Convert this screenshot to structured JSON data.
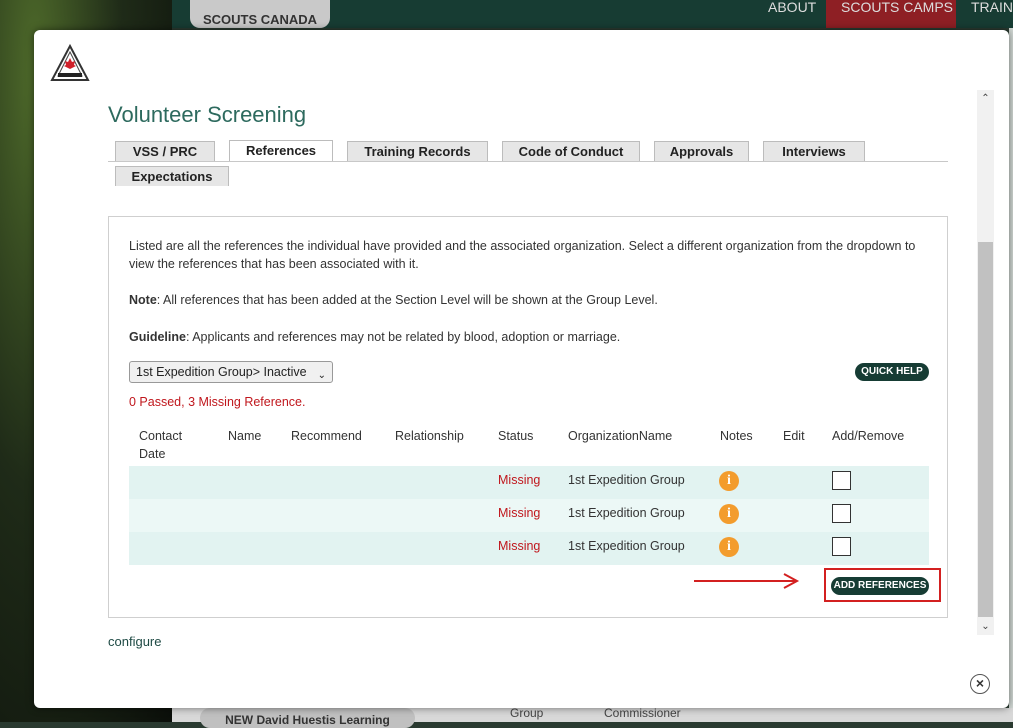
{
  "background": {
    "logo_text": "SCOUTS CANADA",
    "nav": [
      "ABOUT",
      "SCOUTS CAMPS",
      "TRAINI"
    ],
    "bottom_pill": "NEW David Huestis Learning",
    "bottom_texts": [
      "Group",
      "Commissioner"
    ]
  },
  "modal": {
    "title": "Volunteer Screening",
    "close_label": "×",
    "tabs": [
      {
        "label": "VSS / PRC",
        "active": false
      },
      {
        "label": "References",
        "active": true
      },
      {
        "label": "Training Records",
        "active": false
      },
      {
        "label": "Code of Conduct",
        "active": false
      },
      {
        "label": "Approvals",
        "active": false
      },
      {
        "label": "Interviews",
        "active": false
      },
      {
        "label": "Expectations",
        "active": false
      }
    ],
    "intro": "Listed are all the references the individual have provided and the associated organization. Select a different organization from the dropdown to view the references that has been associated with it.",
    "note_label": "Note",
    "note_text": ": All references that has been added at the Section Level will be shown at the Group Level.",
    "guideline_label": "Guideline",
    "guideline_text": ": Applicants and references may not be related by blood, adoption or marriage.",
    "org_select_value": "1st Expedition Group> Inactive",
    "quick_help_label": "QUICK HELP",
    "summary": "0 Passed, 3 Missing Reference.",
    "table": {
      "columns": [
        "Contact Date",
        "Name",
        "Recommend",
        "Relationship",
        "Status",
        "OrganizationName",
        "Notes",
        "Edit",
        "Add/Remove"
      ],
      "rows": [
        {
          "status": "Missing",
          "organization": "1st Expedition Group",
          "note_icon": "info-icon",
          "checked": false
        },
        {
          "status": "Missing",
          "organization": "1st Expedition Group",
          "note_icon": "info-icon",
          "checked": false
        },
        {
          "status": "Missing",
          "organization": "1st Expedition Group",
          "note_icon": "info-icon",
          "checked": false
        }
      ]
    },
    "add_references_label": "ADD REFERENCES",
    "configure_label": "configure"
  },
  "colors": {
    "title": "#2d6a5e",
    "button_bg": "#163c34",
    "missing_red": "#c0171d",
    "row_bg": "#e2f3f1",
    "highlight_red": "#d32020",
    "info_orange": "#f39c2d"
  }
}
